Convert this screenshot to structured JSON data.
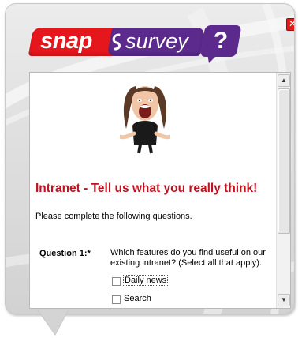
{
  "header": {
    "logo_snap": "snap",
    "logo_survey": "survey",
    "logo_q": "?",
    "close_glyph": "✕"
  },
  "survey": {
    "title": "Intranet - Tell us what you really think!",
    "intro": "Please complete the following questions.",
    "questions": [
      {
        "label": "Question 1:*",
        "text": "Which features do you find useful on our existing intranet? (Select all that apply).",
        "options": [
          {
            "label": "Daily news",
            "checked": false,
            "focused": true
          },
          {
            "label": "Search",
            "checked": false,
            "focused": false
          }
        ]
      }
    ]
  },
  "scrollbar": {
    "up_glyph": "▲",
    "down_glyph": "▼"
  },
  "icons": {
    "close": "close-icon",
    "portrait": "screaming-woman-image",
    "scroll_up": "arrow-up-icon",
    "scroll_down": "arrow-down-icon"
  },
  "colors": {
    "snap_red": "#e6161d",
    "survey_purple": "#5b2a8c",
    "title_red": "#c1121f",
    "close_red": "#e21b1b"
  }
}
